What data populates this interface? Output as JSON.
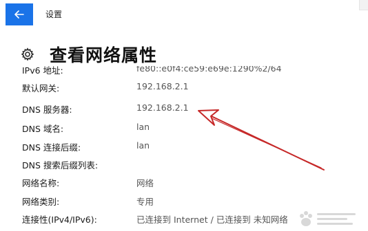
{
  "window": {
    "title": "设置",
    "back_icon": "back-arrow-icon",
    "accent_color": "#1a73e8"
  },
  "page": {
    "title": "查看网络属性",
    "icon": "gear-icon"
  },
  "properties": [
    {
      "label": "IPv6 地址:",
      "value": "fe80::e0f4:ce59:e69e:1290%2/64"
    },
    {
      "label": "默认网关:",
      "value": "192.168.2.1"
    },
    {
      "label": "DNS 服务器:",
      "value": "192.168.2.1"
    },
    {
      "label": "DNS 域名:",
      "value": "lan"
    },
    {
      "label": "DNS 连接后缀:",
      "value": "lan"
    },
    {
      "label": "DNS 搜索后缀列表:",
      "value": ""
    },
    {
      "label": "网络名称:",
      "value": "网络"
    },
    {
      "label": "网络类别:",
      "value": "专用"
    },
    {
      "label": "连接性(IPv4/IPv6):",
      "value": "已连接到 Internet / 已连接到 未知网络"
    }
  ]
}
